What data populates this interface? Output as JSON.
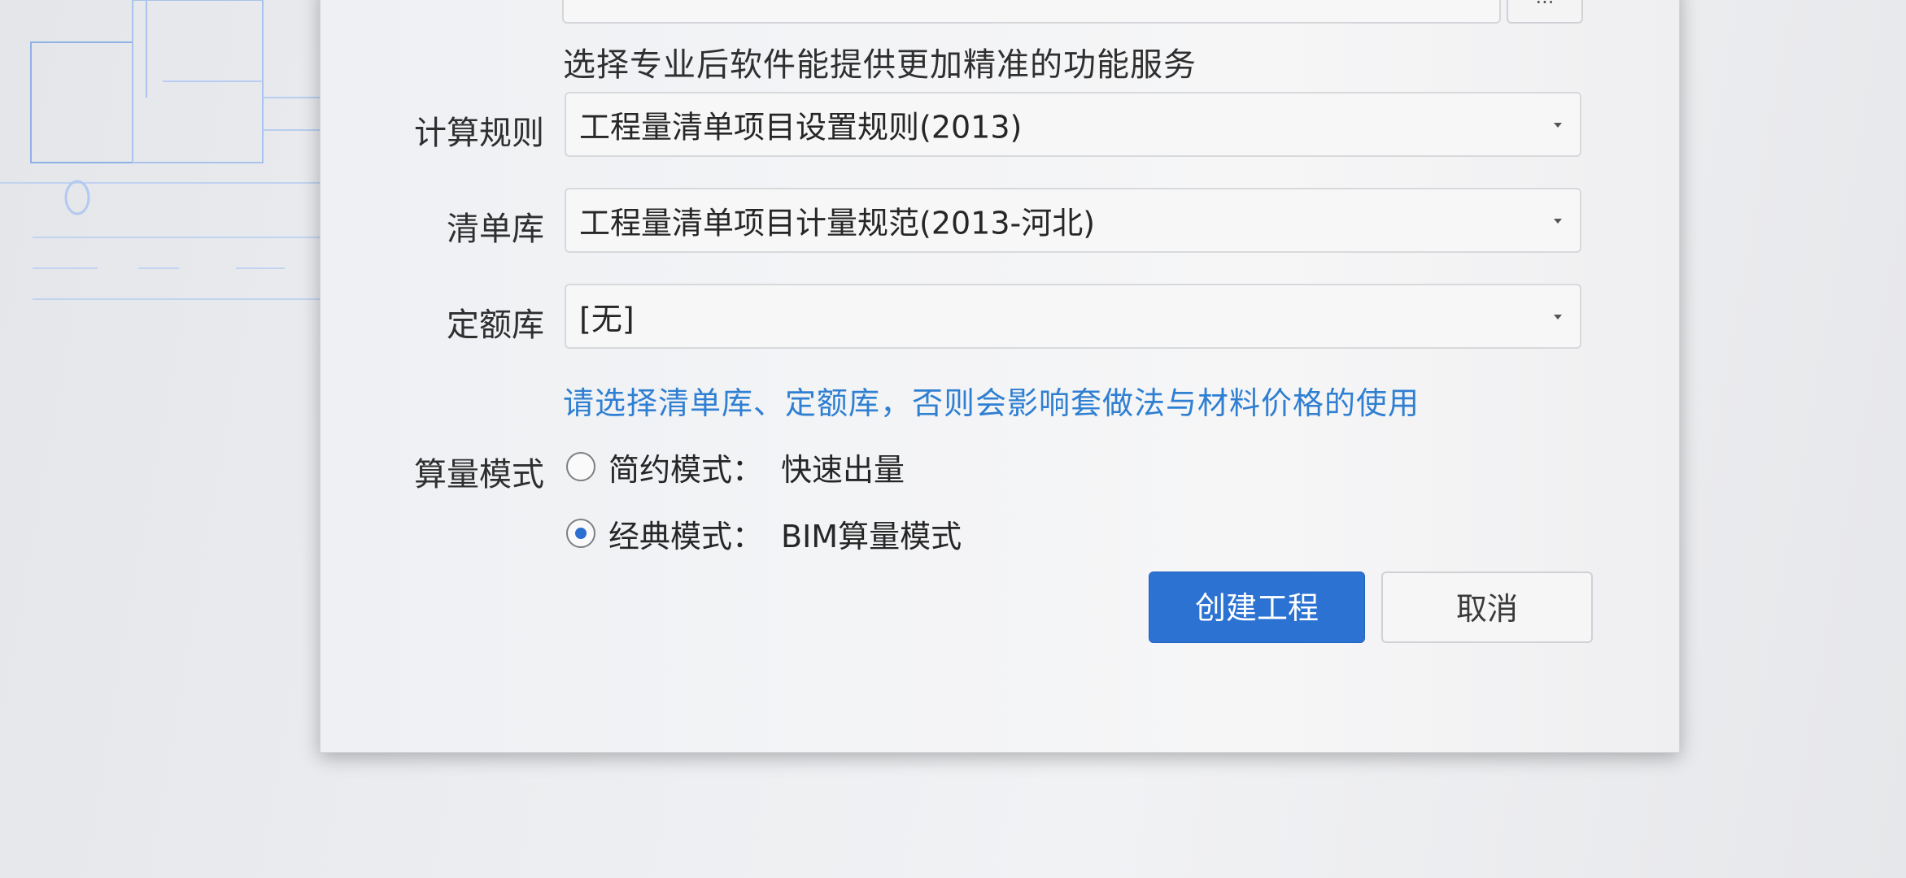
{
  "dialog": {
    "top_button_label": "...",
    "hint_top": "选择专业后软件能提供更加精准的功能服务",
    "calc_rule": {
      "label": "计算规则",
      "value": "工程量清单项目设置规则(2013)"
    },
    "bill_library": {
      "label": "清单库",
      "value": "工程量清单项目计量规范(2013-河北)"
    },
    "quota_library": {
      "label": "定额库",
      "value": "[无]"
    },
    "hint_blue": "请选择清单库、定额库，否则会影响套做法与材料价格的使用",
    "calc_mode": {
      "label": "算量模式",
      "options": [
        {
          "name": "简约模式：",
          "desc": "快速出量",
          "checked": false
        },
        {
          "name": "经典模式：",
          "desc": "BIM算量模式",
          "checked": true
        }
      ]
    },
    "buttons": {
      "create": "创建工程",
      "cancel": "取消"
    }
  },
  "colors": {
    "primary": "#2c72d2",
    "hint_blue": "#2f7fd2",
    "background": "#eceef1"
  }
}
